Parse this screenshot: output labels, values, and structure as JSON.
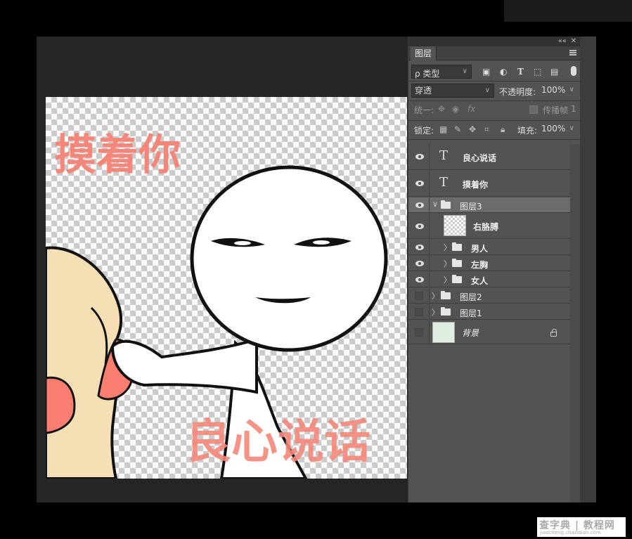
{
  "panel": {
    "tab_label": "图层",
    "filter": {
      "kind_label": "ρ 类型"
    },
    "blend": {
      "mode": "穿透",
      "opacity_label": "不透明度:",
      "opacity_value": "100%"
    },
    "unify": {
      "label": "统一:",
      "propagate_label": "传播帧",
      "propagate_value": "1"
    },
    "lock": {
      "label": "锁定:",
      "fill_label": "填充:",
      "fill_value": "100%"
    }
  },
  "layers": [
    {
      "name": "良心说话",
      "type": "text",
      "visible": true
    },
    {
      "name": "摸着你",
      "type": "text",
      "visible": true
    },
    {
      "name": "图层3",
      "type": "group",
      "visible": true,
      "expanded": true,
      "selected": true
    },
    {
      "name": "右胳膊",
      "type": "pixel",
      "visible": true
    },
    {
      "name": "男人",
      "type": "group",
      "visible": true
    },
    {
      "name": "左胸",
      "type": "group",
      "visible": true
    },
    {
      "name": "女人",
      "type": "group",
      "visible": true
    },
    {
      "name": "图层2",
      "type": "group",
      "visible": false
    },
    {
      "name": "图层1",
      "type": "group",
      "visible": false
    },
    {
      "name": "背景",
      "type": "background",
      "visible": false,
      "locked": true
    }
  ],
  "canvas": {
    "text_top": "摸着你",
    "text_bottom": "良心说话",
    "text_color": "#f4877a"
  },
  "watermark": {
    "main": "查字典 | 教程网",
    "sub": "jiaocheng.chazidian.com"
  }
}
